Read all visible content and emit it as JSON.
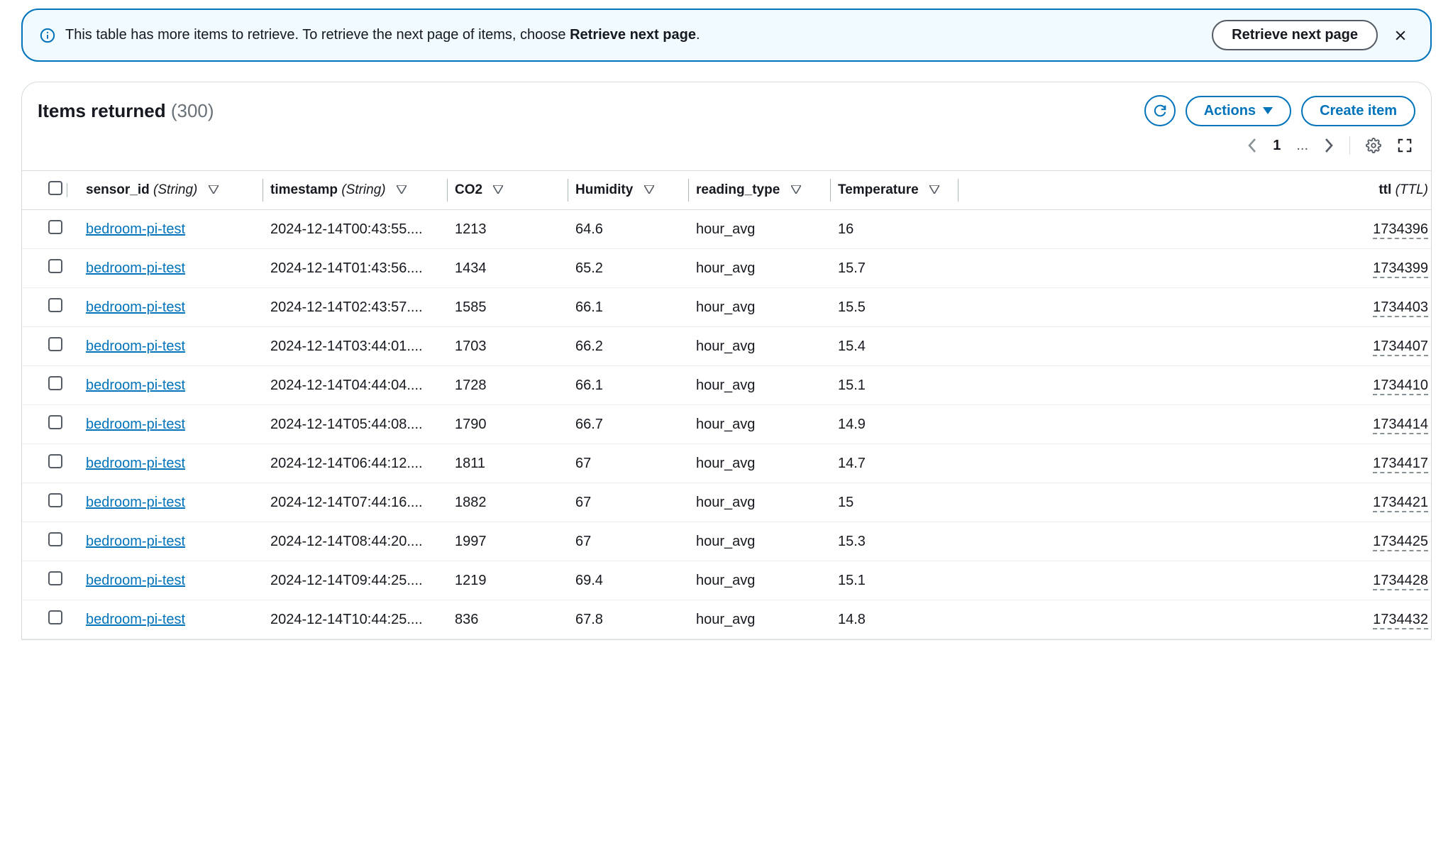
{
  "banner": {
    "msg_pre": "This table has more items to retrieve. To retrieve the next page of items, choose ",
    "msg_bold": "Retrieve next page",
    "msg_post": ".",
    "retrieve_btn": "Retrieve next page"
  },
  "panel": {
    "title": "Items returned",
    "count": "(300)",
    "actions_label": "Actions",
    "create_label": "Create item"
  },
  "pagination": {
    "page": "1",
    "ellipsis": "..."
  },
  "columns": {
    "sensor_id": {
      "name": "sensor_id",
      "type": "(String)"
    },
    "timestamp": {
      "name": "timestamp",
      "type": "(String)"
    },
    "co2": {
      "name": "CO2"
    },
    "humidity": {
      "name": "Humidity"
    },
    "reading_type": {
      "name": "reading_type"
    },
    "temperature": {
      "name": "Temperature"
    },
    "ttl": {
      "name": "ttl",
      "type": "(TTL)"
    }
  },
  "rows": [
    {
      "sensor_id": "bedroom-pi-test",
      "timestamp": "2024-12-14T00:43:55....",
      "co2": "1213",
      "humidity": "64.6",
      "reading_type": "hour_avg",
      "temperature": "16",
      "ttl": "1734396"
    },
    {
      "sensor_id": "bedroom-pi-test",
      "timestamp": "2024-12-14T01:43:56....",
      "co2": "1434",
      "humidity": "65.2",
      "reading_type": "hour_avg",
      "temperature": "15.7",
      "ttl": "1734399"
    },
    {
      "sensor_id": "bedroom-pi-test",
      "timestamp": "2024-12-14T02:43:57....",
      "co2": "1585",
      "humidity": "66.1",
      "reading_type": "hour_avg",
      "temperature": "15.5",
      "ttl": "1734403"
    },
    {
      "sensor_id": "bedroom-pi-test",
      "timestamp": "2024-12-14T03:44:01....",
      "co2": "1703",
      "humidity": "66.2",
      "reading_type": "hour_avg",
      "temperature": "15.4",
      "ttl": "1734407"
    },
    {
      "sensor_id": "bedroom-pi-test",
      "timestamp": "2024-12-14T04:44:04....",
      "co2": "1728",
      "humidity": "66.1",
      "reading_type": "hour_avg",
      "temperature": "15.1",
      "ttl": "1734410"
    },
    {
      "sensor_id": "bedroom-pi-test",
      "timestamp": "2024-12-14T05:44:08....",
      "co2": "1790",
      "humidity": "66.7",
      "reading_type": "hour_avg",
      "temperature": "14.9",
      "ttl": "1734414"
    },
    {
      "sensor_id": "bedroom-pi-test",
      "timestamp": "2024-12-14T06:44:12....",
      "co2": "1811",
      "humidity": "67",
      "reading_type": "hour_avg",
      "temperature": "14.7",
      "ttl": "1734417"
    },
    {
      "sensor_id": "bedroom-pi-test",
      "timestamp": "2024-12-14T07:44:16....",
      "co2": "1882",
      "humidity": "67",
      "reading_type": "hour_avg",
      "temperature": "15",
      "ttl": "1734421"
    },
    {
      "sensor_id": "bedroom-pi-test",
      "timestamp": "2024-12-14T08:44:20....",
      "co2": "1997",
      "humidity": "67",
      "reading_type": "hour_avg",
      "temperature": "15.3",
      "ttl": "1734425"
    },
    {
      "sensor_id": "bedroom-pi-test",
      "timestamp": "2024-12-14T09:44:25....",
      "co2": "1219",
      "humidity": "69.4",
      "reading_type": "hour_avg",
      "temperature": "15.1",
      "ttl": "1734428"
    },
    {
      "sensor_id": "bedroom-pi-test",
      "timestamp": "2024-12-14T10:44:25....",
      "co2": "836",
      "humidity": "67.8",
      "reading_type": "hour_avg",
      "temperature": "14.8",
      "ttl": "1734432"
    }
  ]
}
